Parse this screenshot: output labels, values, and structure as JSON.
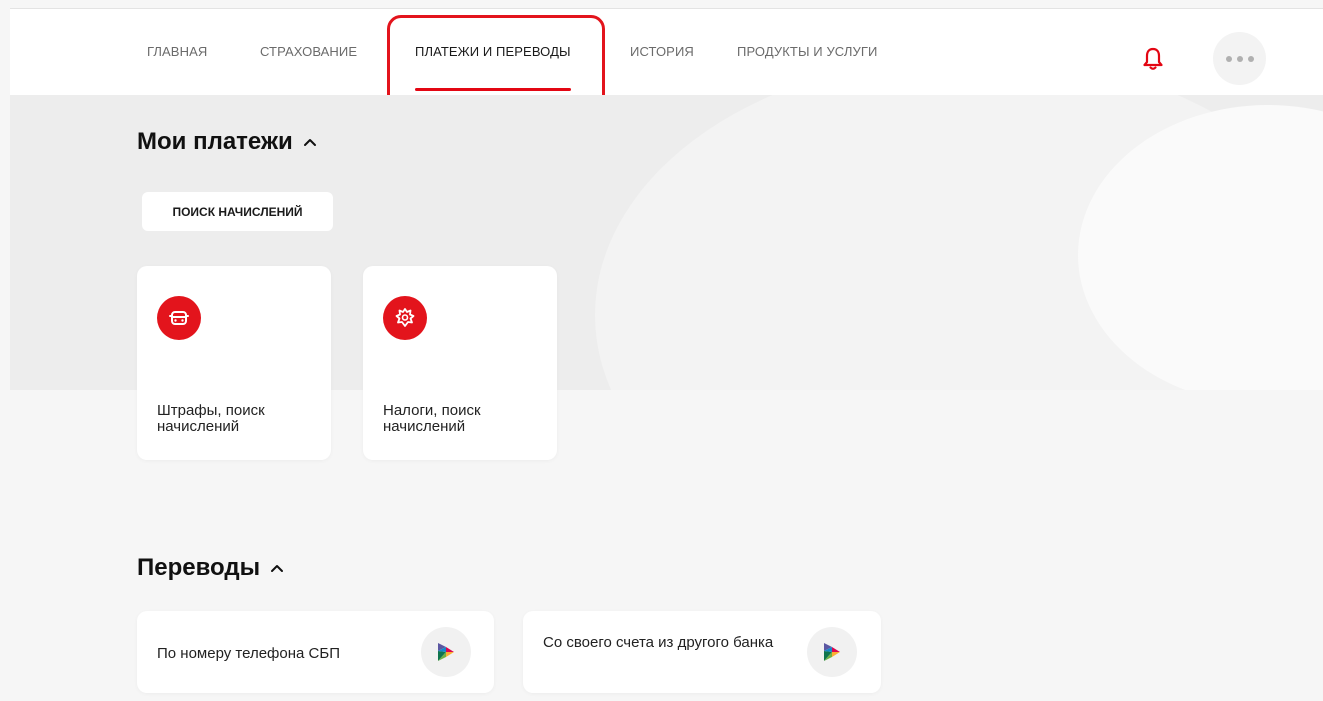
{
  "nav": {
    "items": [
      {
        "label": "ГЛАВНАЯ"
      },
      {
        "label": "СТРАХОВАНИЕ"
      },
      {
        "label": "ПЛАТЕЖИ И ПЕРЕВОДЫ",
        "active": true
      },
      {
        "label": "ИСТОРИЯ"
      },
      {
        "label": "ПРОДУКТЫ И УСЛУГИ"
      }
    ],
    "icons": {
      "notifications": "bell-icon",
      "more": "more-dots-icon"
    }
  },
  "payments": {
    "title": "Мои платежи",
    "search_chip": "ПОИСК НАЧИСЛЕНИЙ",
    "tiles": [
      {
        "label": "Штрафы, поиск начислений",
        "icon": "car-icon"
      },
      {
        "label": "Налоги, поиск начислений",
        "icon": "emblem-icon"
      }
    ]
  },
  "transfers": {
    "title": "Переводы",
    "items": [
      {
        "label": "По номеру телефона СБП",
        "icon": "sbp-icon"
      },
      {
        "label": "Со своего счета из другого банка",
        "icon": "sbp-icon"
      }
    ]
  },
  "colors": {
    "accent": "#e30613",
    "highlight": "#e3141c",
    "background": "#f6f6f6"
  }
}
